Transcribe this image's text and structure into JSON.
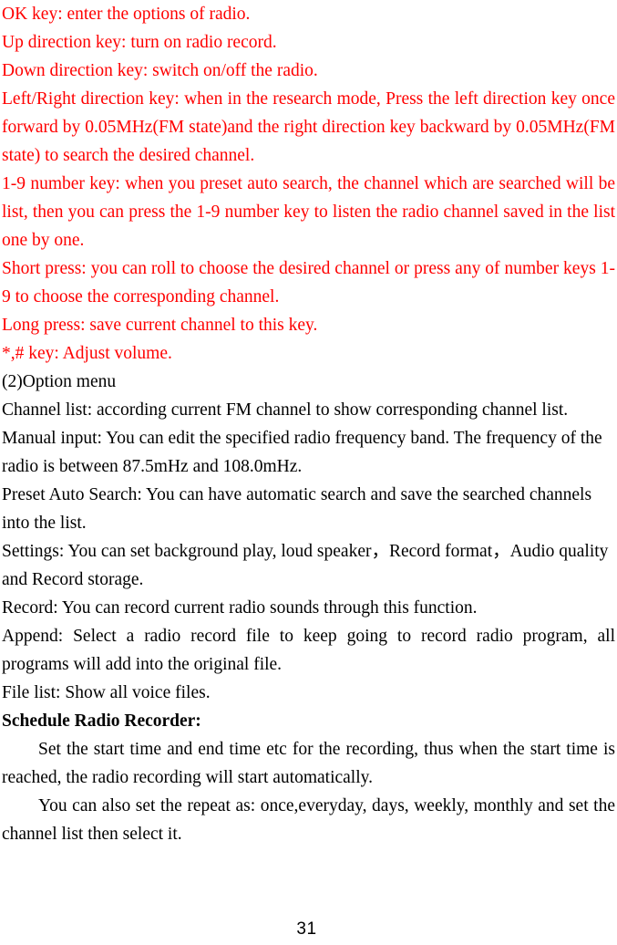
{
  "colors": {
    "red": "#ff0000",
    "black": "#000000",
    "background": "#ffffff"
  },
  "document": {
    "page_number": "31",
    "sections": [
      {
        "id": "key-functions",
        "color": "#ff0000",
        "lines": {
          "ok_key": "OK key: enter the options of radio.",
          "up_key": "Up direction key: turn on radio record.",
          "down_key": "Down direction key: switch on/off the radio.",
          "left_right_key": "Left/Right direction key: when in the research mode, Press the left direction key once forward by 0.05MHz(FM state)and the right direction key backward by 0.05MHz(FM state) to search the desired channel.",
          "number_key": "1-9 number key: when you preset auto search, the channel which are searched will be list, then you can press the 1-9 number key to listen the radio channel saved in the list one by one.",
          "short_press": "Short press: you can roll to choose the desired channel or press any of number keys 1-9 to choose the corresponding channel.",
          "long_press": "Long press: save current channel to this key.",
          "star_hash_key": "*,# key: Adjust volume."
        }
      },
      {
        "id": "option-menu",
        "color": "#000000",
        "heading": "(2)Option menu",
        "lines": {
          "channel_list": "Channel list: according current FM channel to show corresponding channel list.",
          "manual_input": "Manual input: You can edit the specified radio frequency band. The frequency of the radio is between 87.5mHz and 108.0mHz.",
          "preset_auto_search": "Preset Auto Search: You can have automatic search and save the searched channels into the list.",
          "settings": "Settings: You can set background play, loud speaker，Record format，Audio quality and Record storage.",
          "record": "Record: You can record current radio sounds through this function.",
          "append": "Append: Select a radio record file to keep going to record radio program, all programs will add into the original file.",
          "file_list": "File list: Show all voice files."
        }
      },
      {
        "id": "schedule-radio-recorder",
        "color": "#000000",
        "heading": "Schedule Radio Recorder:",
        "lines": {
          "paragraph_1": "Set the start time and end time etc for the recording, thus when the start time is reached, the radio recording will start automatically.",
          "paragraph_2": "You can also set the repeat as: once,everyday, days, weekly, monthly and set the channel list then select it."
        }
      }
    ]
  }
}
